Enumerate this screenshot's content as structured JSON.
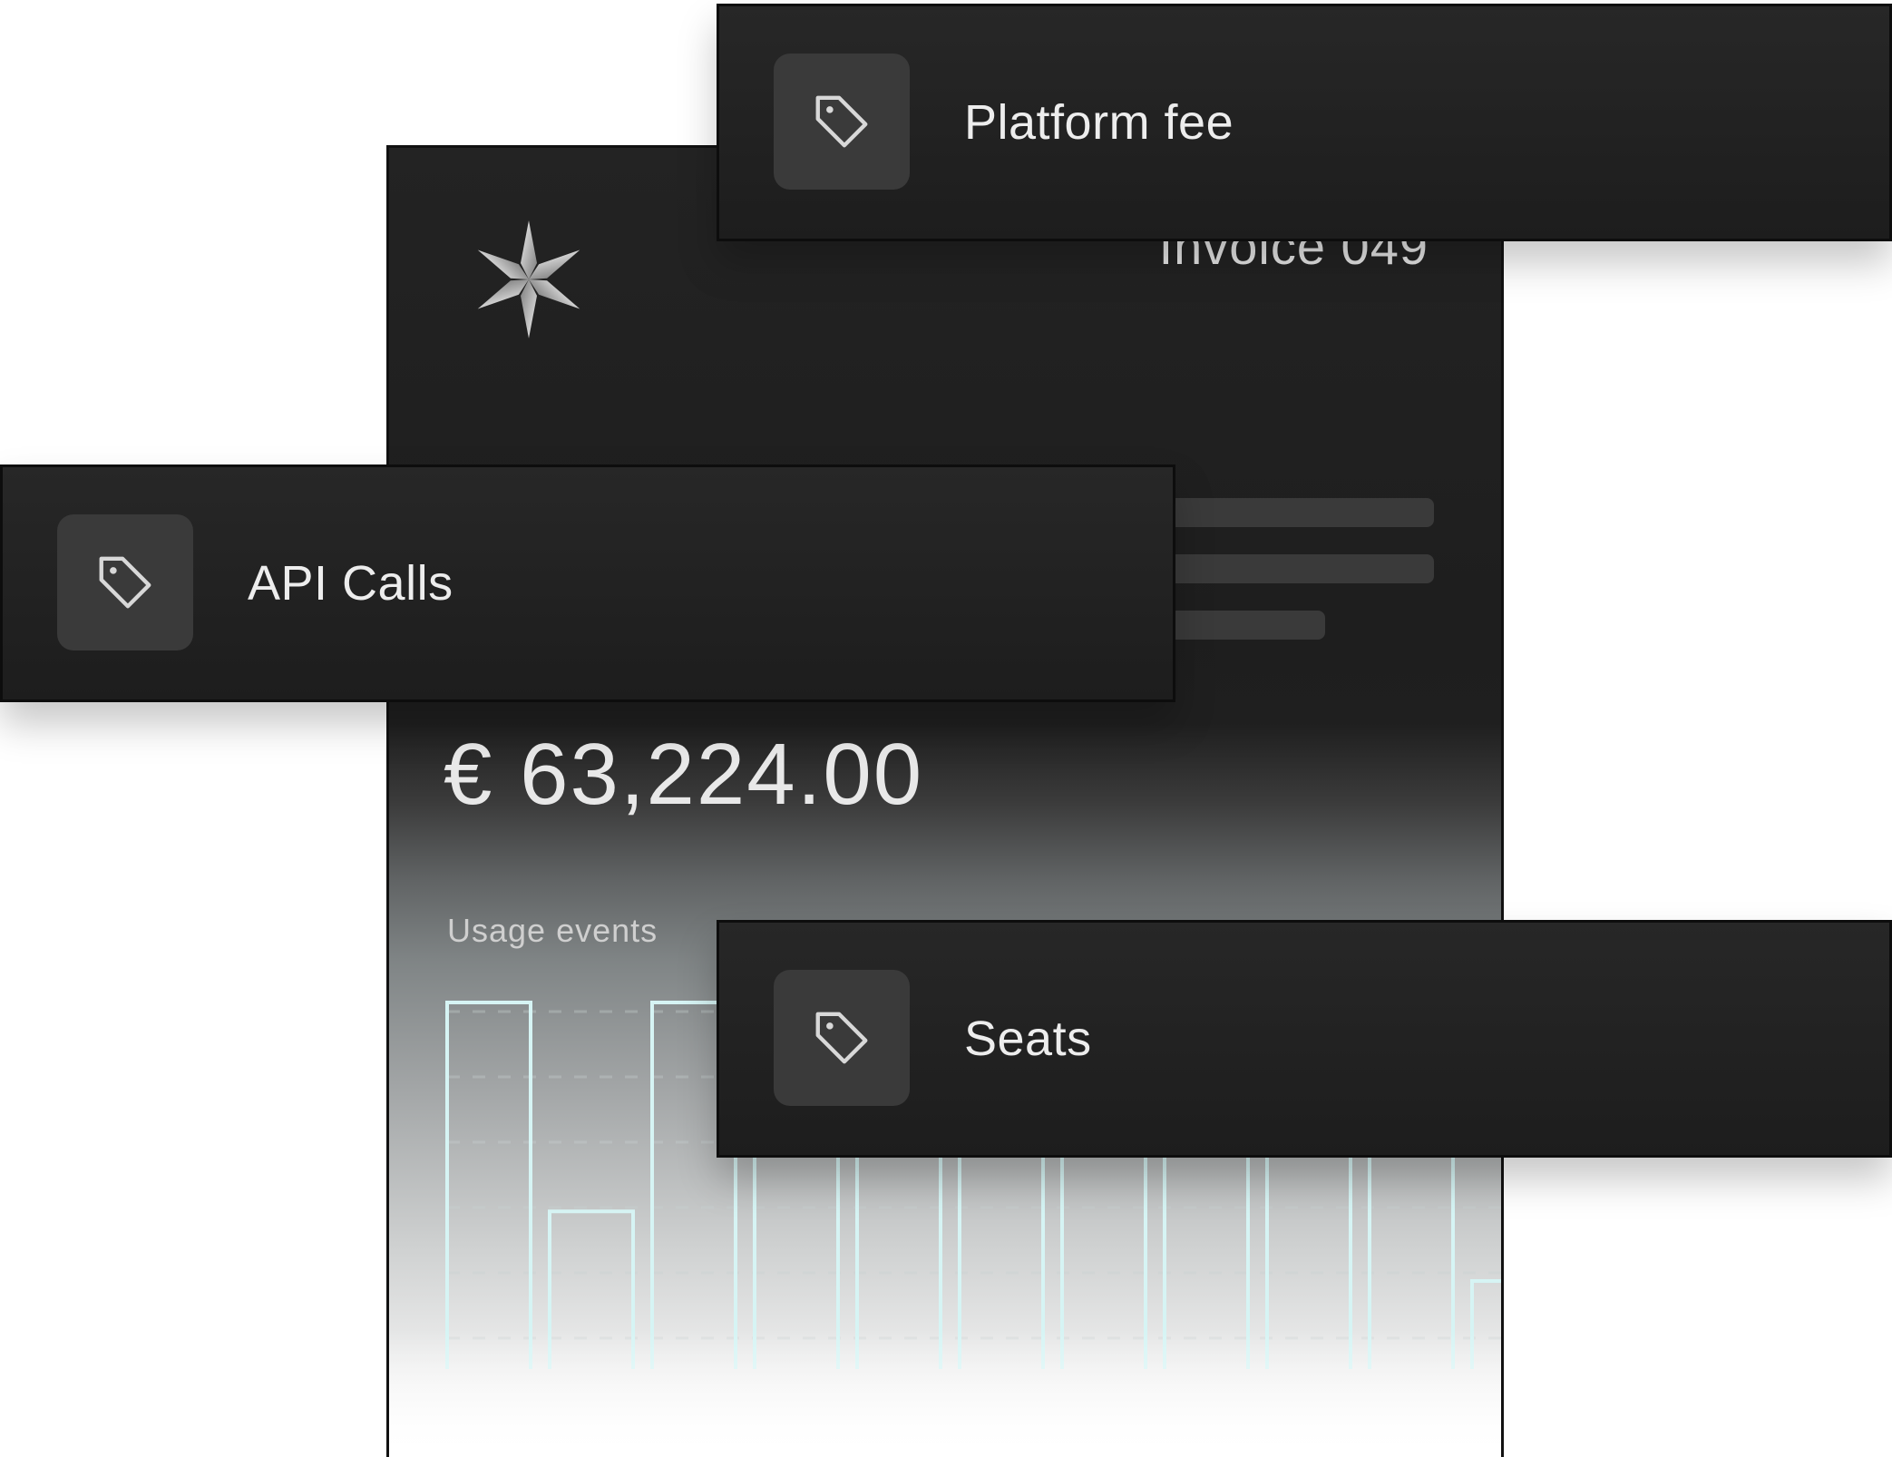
{
  "invoice": {
    "number": "Invoice 049",
    "amount": "€ 63,224.00",
    "usage_label": "Usage events"
  },
  "line_items": [
    {
      "label": "Platform fee",
      "icon": "price-tag-icon"
    },
    {
      "label": "API Calls",
      "icon": "price-tag-icon"
    },
    {
      "label": "Seats",
      "icon": "price-tag-icon"
    }
  ],
  "colors": {
    "card_dark": "#1e1e1e",
    "icon_box": "#3a3a3a",
    "bar_outline": "#d6f4f4",
    "text_light": "#e8e8e8"
  },
  "chart_data": {
    "type": "bar",
    "categories": [],
    "values": [
      1.0,
      0.43,
      1.0,
      1.0,
      1.0,
      1.0,
      1.0,
      1.0,
      1.0,
      1.0,
      0.24
    ],
    "title": "Usage events",
    "xlabel": "",
    "ylabel": "",
    "ylim": [
      0,
      1
    ],
    "grid": true,
    "legend": "none"
  }
}
